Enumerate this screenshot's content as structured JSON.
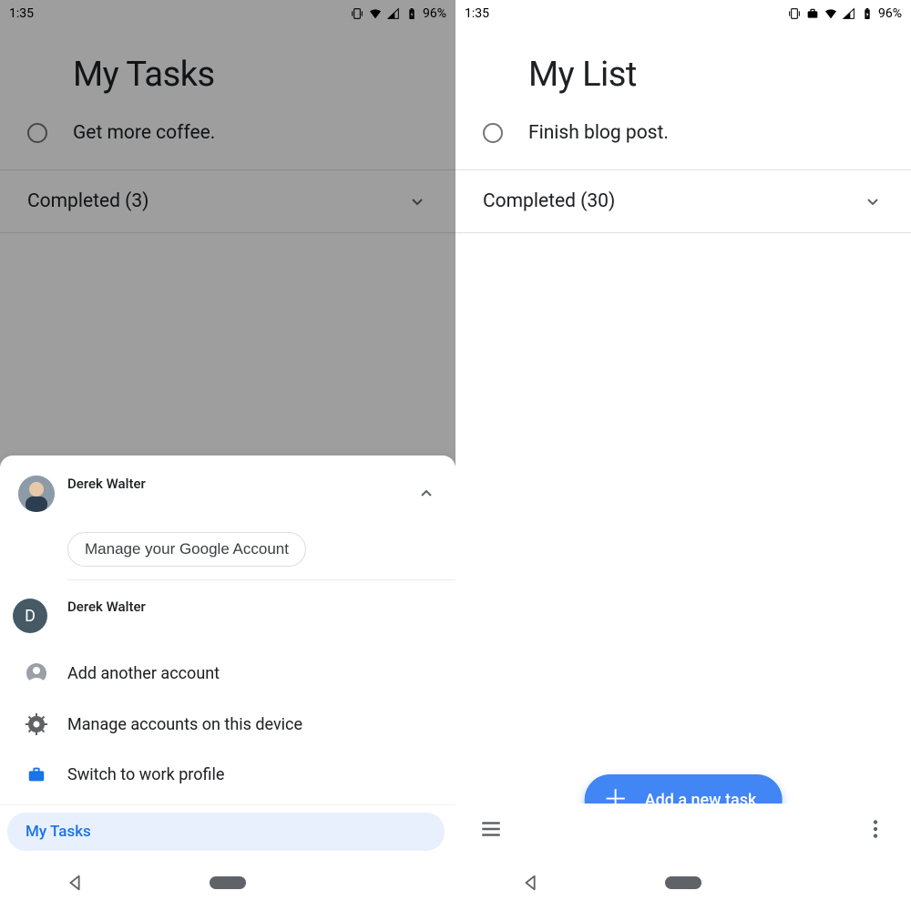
{
  "left": {
    "statusbar": {
      "time": "1:35",
      "battery_pct": "96%"
    },
    "title": "My Tasks",
    "task": "Get more coffee.",
    "completed_label": "Completed (3)",
    "sheet": {
      "primary_account_name": "Derek Walter",
      "primary_account_email": "",
      "manage_button": "Manage your Google Account",
      "secondary_account_name": "Derek Walter",
      "secondary_account_email": "",
      "secondary_avatar_letter": "D",
      "add_account": "Add another account",
      "manage_accounts": "Manage accounts on this device",
      "switch_work": "Switch to work profile"
    },
    "list_chip": "My Tasks"
  },
  "right": {
    "statusbar": {
      "time": "1:35",
      "battery_pct": "96%"
    },
    "title": "My List",
    "task": "Finish blog post.",
    "completed_label": "Completed (30)",
    "fab_label": "Add a new task"
  }
}
